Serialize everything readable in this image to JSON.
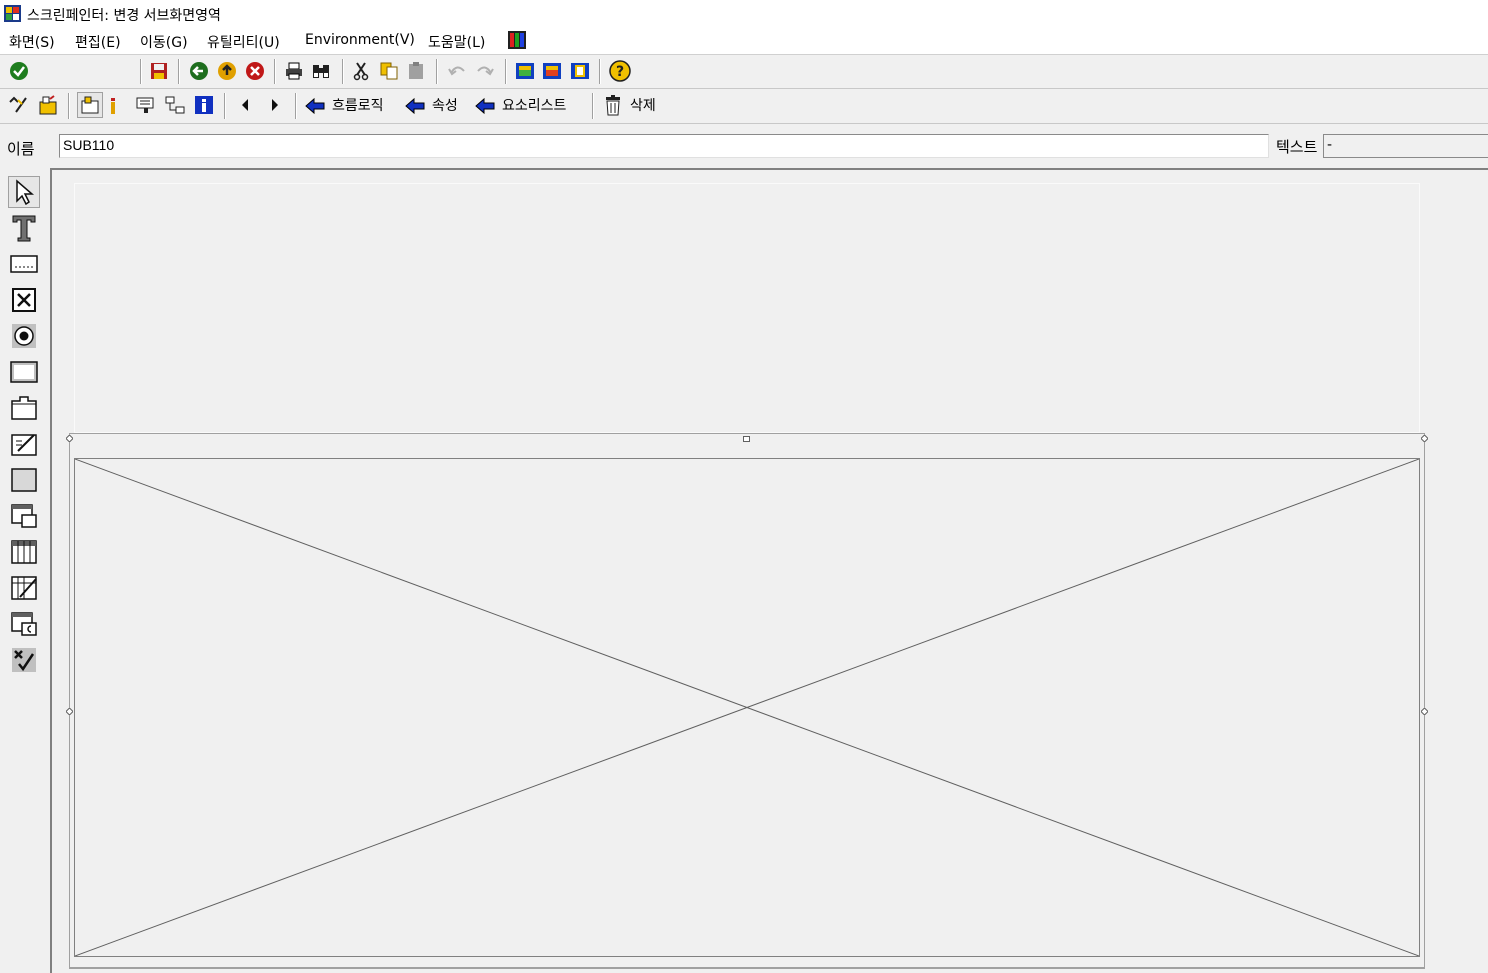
{
  "window": {
    "title": "스크린페인터: 변경 서브화면영역"
  },
  "menu": {
    "items": [
      {
        "label": "화면(S)"
      },
      {
        "label": "편집(E)"
      },
      {
        "label": "이동(G)"
      },
      {
        "label": "유틸리티(U)"
      },
      {
        "label": "Environment(V)"
      },
      {
        "label": "도움말(L)"
      }
    ]
  },
  "toolbar2": {
    "flow_logic": "흐름로직",
    "attributes": "속성",
    "element_list": "요소리스트",
    "delete": "삭제"
  },
  "fields": {
    "name_label": "이름",
    "name_value": "SUB110",
    "text_label": "텍스트",
    "text_value": "-"
  },
  "colors": {
    "accent_green": "#2e8b2e",
    "accent_red": "#c8202a",
    "accent_blue": "#1030c0",
    "accent_yellow": "#f0c000",
    "background": "#f0f0f0"
  }
}
